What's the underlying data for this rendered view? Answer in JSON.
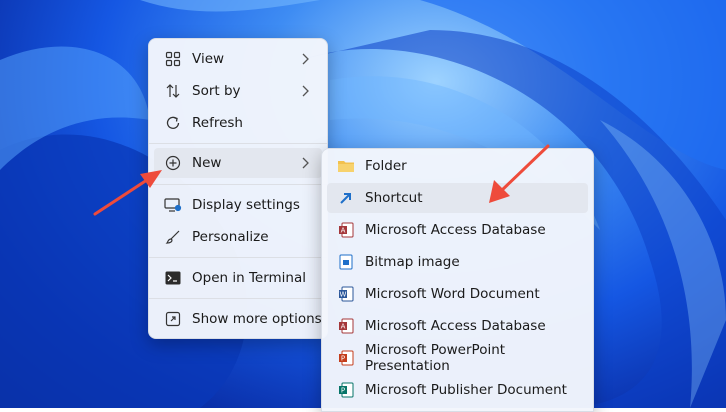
{
  "context_menu": {
    "items": [
      {
        "label": "View",
        "icon": "grid-view-icon",
        "has_submenu": true
      },
      {
        "label": "Sort by",
        "icon": "sort-icon",
        "has_submenu": true
      },
      {
        "label": "Refresh",
        "icon": "refresh-icon",
        "has_submenu": false
      },
      {
        "label": "New",
        "icon": "new-plus-icon",
        "has_submenu": true
      },
      {
        "label": "Display settings",
        "icon": "display-settings-icon",
        "has_submenu": false
      },
      {
        "label": "Personalize",
        "icon": "brush-icon",
        "has_submenu": false
      },
      {
        "label": "Open in Terminal",
        "icon": "terminal-icon",
        "has_submenu": false
      },
      {
        "label": "Show more options",
        "icon": "more-options-icon",
        "has_submenu": false
      }
    ]
  },
  "new_submenu": {
    "items": [
      {
        "label": "Folder",
        "icon": "folder-icon"
      },
      {
        "label": "Shortcut",
        "icon": "shortcut-icon"
      },
      {
        "label": "Microsoft Access Database",
        "icon": "access-icon"
      },
      {
        "label": "Bitmap image",
        "icon": "bitmap-icon"
      },
      {
        "label": "Microsoft Word Document",
        "icon": "word-icon"
      },
      {
        "label": "Microsoft Access Database",
        "icon": "access-icon"
      },
      {
        "label": "Microsoft PowerPoint Presentation",
        "icon": "powerpoint-icon"
      },
      {
        "label": "Microsoft Publisher Document",
        "icon": "publisher-icon"
      }
    ]
  },
  "colors": {
    "annotation_arrow": "#ee4b3b",
    "folder": "#f2c14e",
    "shortcut": "#1e6fc9",
    "access": "#a4373a",
    "word": "#2b579a",
    "powerpoint": "#c43e1c",
    "publisher": "#077568"
  }
}
